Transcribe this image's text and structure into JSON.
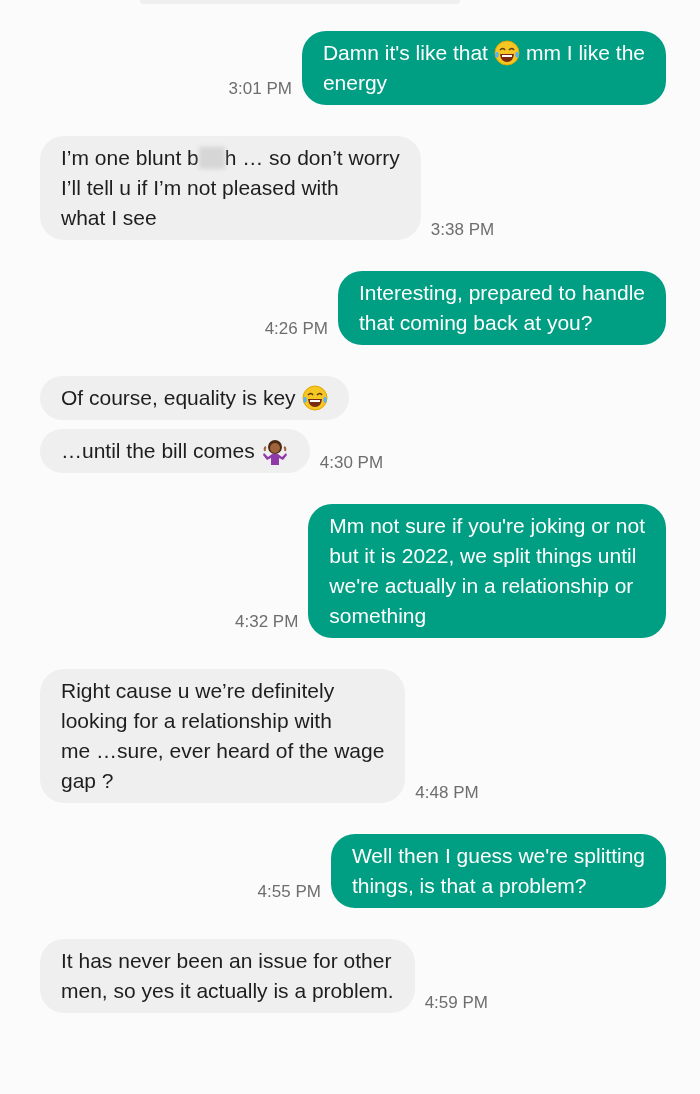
{
  "messages": [
    {
      "kind": "sent",
      "time": "3:01 PM",
      "lines": [
        [
          {
            "kind": "text",
            "text": "Damn it's like that"
          },
          {
            "kind": "laughing-emoji"
          },
          {
            "kind": "text",
            "text": "mm I like the"
          }
        ],
        [
          {
            "kind": "text",
            "text": "energy"
          }
        ]
      ]
    },
    {
      "kind": "received",
      "time": "3:38 PM",
      "lines": [
        [
          {
            "kind": "text",
            "text": "I’m one blunt b"
          },
          {
            "kind": "censor"
          },
          {
            "kind": "text",
            "text": "h … so don’t worry"
          }
        ],
        [
          {
            "kind": "text",
            "text": "I’ll tell u if I’m not pleased with"
          }
        ],
        [
          {
            "kind": "text",
            "text": "what I see"
          }
        ]
      ]
    },
    {
      "kind": "sent",
      "time": "4:26 PM",
      "lines": [
        [
          {
            "kind": "text",
            "text": "Interesting, prepared to handle"
          }
        ],
        [
          {
            "kind": "text",
            "text": "that coming back at you?"
          }
        ]
      ]
    },
    {
      "kind": "received",
      "lines": [
        [
          {
            "kind": "text",
            "text": "Of course, equality is key"
          },
          {
            "kind": "laughing-emoji"
          }
        ]
      ]
    },
    {
      "kind": "received",
      "time": "4:30 PM",
      "lines": [
        [
          {
            "kind": "text",
            "text": "…until the bill comes"
          },
          {
            "kind": "shrug-emoji"
          }
        ]
      ]
    },
    {
      "kind": "sent",
      "time": "4:32 PM",
      "lines": [
        [
          {
            "kind": "text",
            "text": "Mm not sure if you're joking or not"
          }
        ],
        [
          {
            "kind": "text",
            "text": "but it is 2022, we split things until"
          }
        ],
        [
          {
            "kind": "text",
            "text": "we're actually in a relationship or"
          }
        ],
        [
          {
            "kind": "text",
            "text": "something"
          }
        ]
      ]
    },
    {
      "kind": "received",
      "time": "4:48 PM",
      "lines": [
        [
          {
            "kind": "text",
            "text": "Right cause u we’re definitely"
          }
        ],
        [
          {
            "kind": "text",
            "text": "looking for a relationship with"
          }
        ],
        [
          {
            "kind": "text",
            "text": "me …sure, ever heard of the wage"
          }
        ],
        [
          {
            "kind": "text",
            "text": "gap ?"
          }
        ]
      ]
    },
    {
      "kind": "sent",
      "time": "4:55 PM",
      "lines": [
        [
          {
            "kind": "text",
            "text": "Well then I guess we're splitting"
          }
        ],
        [
          {
            "kind": "text",
            "text": "things, is that a problem?"
          }
        ]
      ]
    },
    {
      "kind": "received",
      "time": "4:59 PM",
      "lines": [
        [
          {
            "kind": "text",
            "text": "It has never been an issue for other"
          }
        ],
        [
          {
            "kind": "text",
            "text": "men, so yes it actually is a problem."
          }
        ]
      ]
    }
  ]
}
